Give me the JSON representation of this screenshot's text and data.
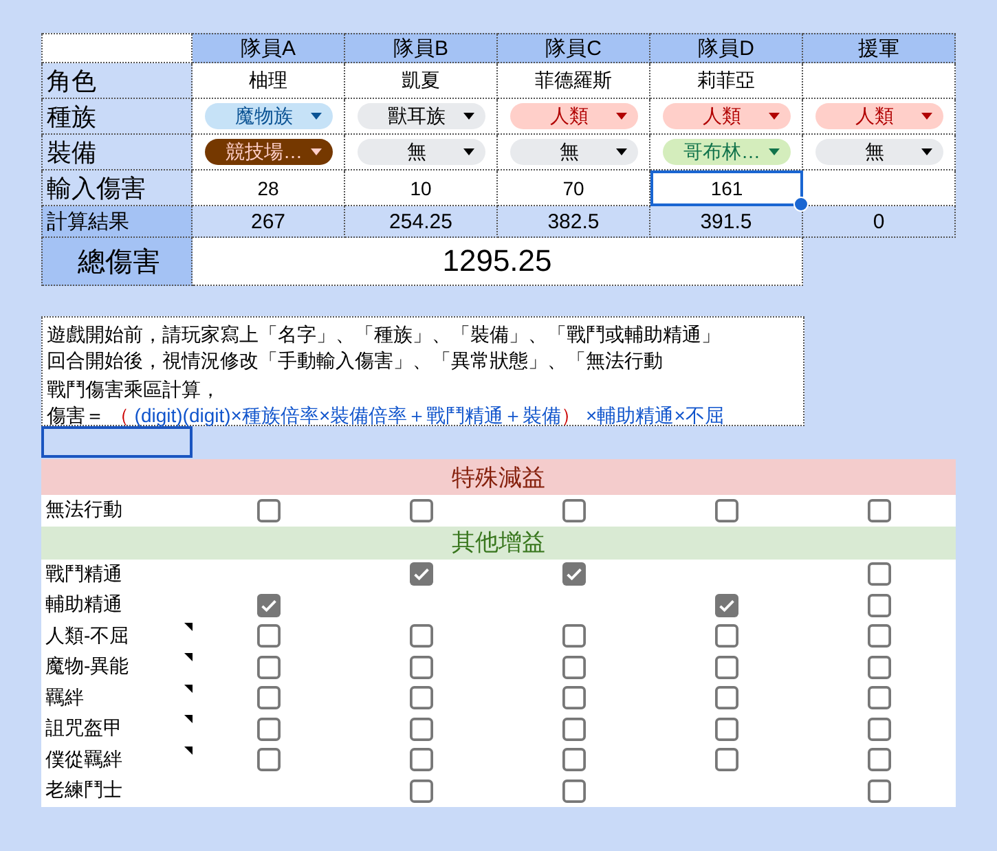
{
  "columns": [
    "隊員A",
    "隊員B",
    "隊員C",
    "隊員D",
    "援軍"
  ],
  "rows": [
    {
      "kind": "text",
      "label": "角色",
      "cells": [
        "柚理",
        "凱夏",
        "菲德羅斯",
        "莉菲亞",
        ""
      ]
    },
    {
      "kind": "chip",
      "label": "種族",
      "cells": [
        {
          "text": "魔物族",
          "color": "#c6e2f7"
        },
        {
          "text": "獸耳族",
          "color": "#e8eaed"
        },
        {
          "text": "人類",
          "color": "#ffcfc9"
        },
        {
          "text": "人類",
          "color": "#ffcfc9"
        },
        {
          "text": "人類",
          "color": "#ffcfc9"
        }
      ]
    },
    {
      "kind": "chip",
      "label": "裝備",
      "cells": [
        {
          "text": "競技場…",
          "color": "#753800"
        },
        {
          "text": "無",
          "color": "#e8eaed"
        },
        {
          "text": "無",
          "color": "#e8eaed"
        },
        {
          "text": "哥布林…",
          "color": "#d4edbc"
        },
        {
          "text": "無",
          "color": "#e8eaed"
        }
      ]
    },
    {
      "kind": "input",
      "label": "輸入傷害",
      "cells": [
        {
          "text": "28",
          "selected": false
        },
        {
          "text": "10",
          "selected": false
        },
        {
          "text": "70",
          "selected": false
        },
        {
          "text": "161",
          "selected": true
        },
        {
          "text": "",
          "selected": false
        }
      ]
    },
    {
      "kind": "result",
      "label": "計算結果",
      "cells": [
        "267",
        "254.25",
        "382.5",
        "391.5",
        "0"
      ]
    }
  ],
  "total": {
    "label": "總傷害",
    "value": "1295.25"
  },
  "notes": [
    "遊戲開始前，請玩家寫上「名字」、「種族」、「裝備」、「戰鬥或輔助精通」",
    "回合開始後，視情況修改「手動輸入傷害」、「異常狀態」、「無法行動"
  ],
  "formula_title": "戰鬥傷害乘區計算，",
  "formula": [
    {
      "text": "傷害＝ ",
      "color": "#000000"
    },
    {
      "text": "（ ",
      "color": "#cc0000"
    },
    {
      "text": "(digit)(digit)×種族倍率×裝備倍率＋戰鬥精通＋裝備",
      "color": "#1155cc"
    },
    {
      "text": "）",
      "color": "#cc0000"
    },
    {
      "text": " ×輔助精通×不屈",
      "color": "#1155cc"
    }
  ],
  "sections": [
    {
      "title": "特殊減益",
      "kind": "debuff",
      "rows": [
        {
          "label": "無法行動",
          "has_note": false,
          "cells": [
            {
              "kind": "checkbox",
              "checked": false
            },
            {
              "kind": "checkbox",
              "checked": false
            },
            {
              "kind": "checkbox",
              "checked": false
            },
            {
              "kind": "checkbox",
              "checked": false
            },
            {
              "kind": "checkbox",
              "checked": false
            }
          ]
        }
      ]
    },
    {
      "title": "其他增益",
      "kind": "buff",
      "rows": [
        {
          "label": "戰鬥精通",
          "has_note": false,
          "cells": [
            {
              "kind": "blank"
            },
            {
              "kind": "checkbox",
              "checked": true
            },
            {
              "kind": "checkbox",
              "checked": true
            },
            {
              "kind": "blank"
            },
            {
              "kind": "checkbox",
              "checked": false
            }
          ]
        },
        {
          "label": "輔助精通",
          "has_note": false,
          "cells": [
            {
              "kind": "checkbox",
              "checked": true
            },
            {
              "kind": "blank"
            },
            {
              "kind": "blank"
            },
            {
              "kind": "checkbox",
              "checked": true
            },
            {
              "kind": "checkbox",
              "checked": false
            }
          ]
        },
        {
          "label": "人類-不屈",
          "has_note": true,
          "cells": [
            {
              "kind": "checkbox",
              "checked": false
            },
            {
              "kind": "checkbox",
              "checked": false
            },
            {
              "kind": "checkbox",
              "checked": false
            },
            {
              "kind": "checkbox",
              "checked": false
            },
            {
              "kind": "checkbox",
              "checked": false
            }
          ]
        },
        {
          "label": "魔物-異能",
          "has_note": true,
          "cells": [
            {
              "kind": "checkbox",
              "checked": false
            },
            {
              "kind": "checkbox",
              "checked": false
            },
            {
              "kind": "checkbox",
              "checked": false
            },
            {
              "kind": "checkbox",
              "checked": false
            },
            {
              "kind": "checkbox",
              "checked": false
            }
          ]
        },
        {
          "label": "羈絆",
          "has_note": true,
          "cells": [
            {
              "kind": "checkbox",
              "checked": false
            },
            {
              "kind": "checkbox",
              "checked": false
            },
            {
              "kind": "checkbox",
              "checked": false
            },
            {
              "kind": "checkbox",
              "checked": false
            },
            {
              "kind": "checkbox",
              "checked": false
            }
          ]
        },
        {
          "label": "詛咒盔甲",
          "has_note": true,
          "cells": [
            {
              "kind": "checkbox",
              "checked": false
            },
            {
              "kind": "checkbox",
              "checked": false
            },
            {
              "kind": "checkbox",
              "checked": false
            },
            {
              "kind": "checkbox",
              "checked": false
            },
            {
              "kind": "checkbox",
              "checked": false
            }
          ]
        },
        {
          "label": "僕從羈絆",
          "has_note": true,
          "cells": [
            {
              "kind": "checkbox",
              "checked": false
            },
            {
              "kind": "checkbox",
              "checked": false
            },
            {
              "kind": "checkbox",
              "checked": false
            },
            {
              "kind": "checkbox",
              "checked": false
            },
            {
              "kind": "checkbox",
              "checked": false
            }
          ]
        },
        {
          "label": "老練鬥士",
          "has_note": false,
          "cells": [
            {
              "kind": "blank"
            },
            {
              "kind": "checkbox",
              "checked": false
            },
            {
              "kind": "checkbox",
              "checked": false
            },
            {
              "kind": "blank"
            },
            {
              "kind": "checkbox",
              "checked": false
            }
          ]
        }
      ]
    }
  ]
}
